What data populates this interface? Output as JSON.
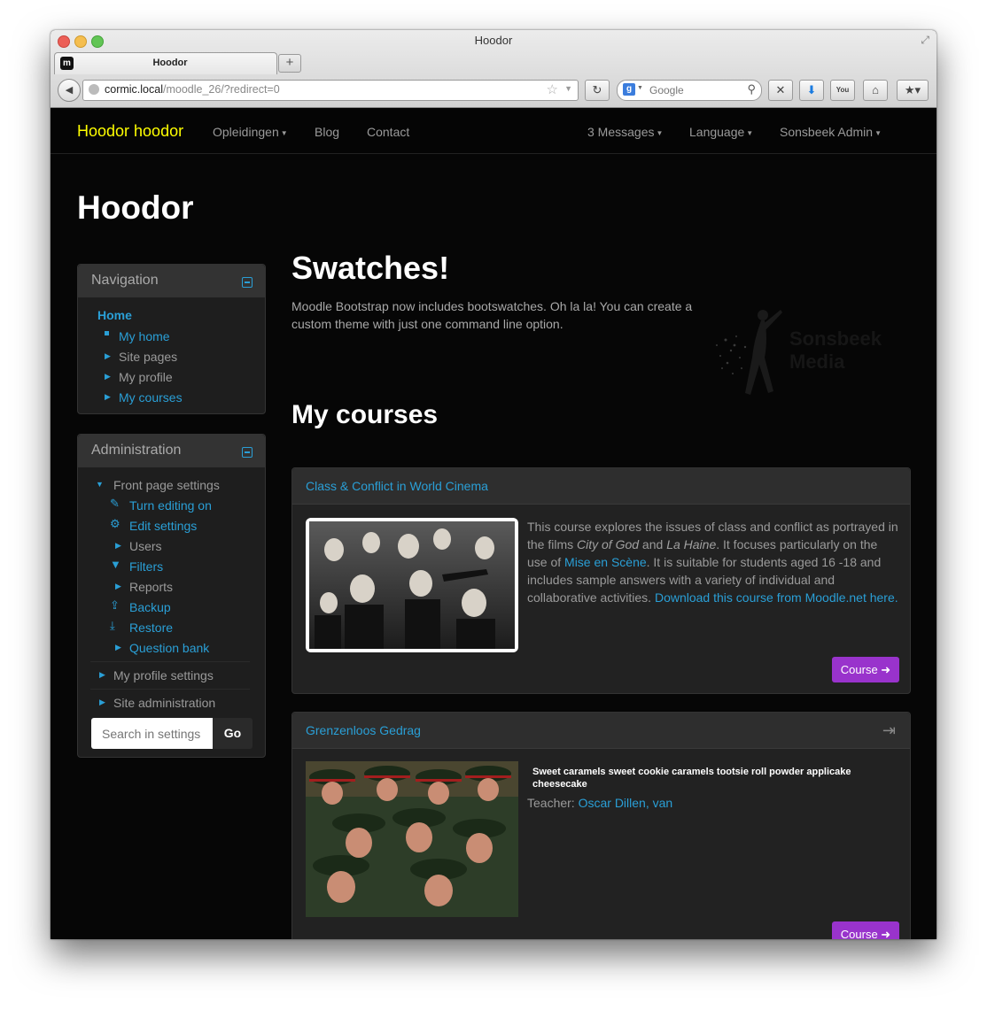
{
  "browser": {
    "window_title": "Hoodor",
    "tab_title": "Hoodor",
    "new_tab_label": "+",
    "url_host": "cormic.local",
    "url_path": "/moodle_26/?redirect=0",
    "search_placeholder": "Google"
  },
  "navbar": {
    "brand": "Hoodor hoodor",
    "links": [
      "Opleidingen",
      "Blog",
      "Contact"
    ],
    "right_links": [
      "3 Messages",
      "Language",
      "Sonsbeek Admin"
    ]
  },
  "page": {
    "heading": "Hoodor"
  },
  "navigation_block": {
    "title": "Navigation",
    "home": "Home",
    "items": [
      "My home",
      "Site pages",
      "My profile",
      "My courses"
    ]
  },
  "admin_block": {
    "title": "Administration",
    "front_page_settings": "Front page settings",
    "items": [
      "Turn editing on",
      "Edit settings",
      "Users",
      "Filters",
      "Reports",
      "Backup",
      "Restore",
      "Question bank"
    ],
    "my_profile_settings": "My profile settings",
    "site_administration": "Site administration",
    "search_placeholder": "Search in settings",
    "go_label": "Go"
  },
  "hero": {
    "title": "Swatches!",
    "text": "Moodle Bootstrap now includes bootswatches. Oh la la! You can create a custom theme with just one command line option.",
    "logo_line1": "Sonsbeek",
    "logo_line2": "Media"
  },
  "courses_section": {
    "heading": "My courses"
  },
  "courses": [
    {
      "name": "Class & Conflict in World Cinema",
      "summary_intro": "This course explores the issues of class and conflict as portrayed in the films ",
      "film1": "City of God",
      "and": " and ",
      "film2": "La Haine",
      "summary_mid": ". It focuses particularly on the use of ",
      "link1": "Mise en Scène",
      "summary_end": ".  It is suitable for students aged 16 -18 and includes sample answers with a variety of individual and collaborative activities. ",
      "link2": "Download this course from Moodle.net here",
      "period": ".",
      "button": "Course ➜"
    },
    {
      "name": "Grenzenloos Gedrag",
      "summary": "Sweet caramels sweet cookie caramels tootsie roll powder applicake cheesecake",
      "teacher_label": "Teacher: ",
      "teacher_name": "Oscar Dillen, van",
      "button": "Course ➜"
    }
  ],
  "colors": {
    "brand": "#ffff00",
    "link": "#2a9fd6",
    "button": "#9933cc",
    "background": "#060606",
    "panel": "#222222"
  }
}
